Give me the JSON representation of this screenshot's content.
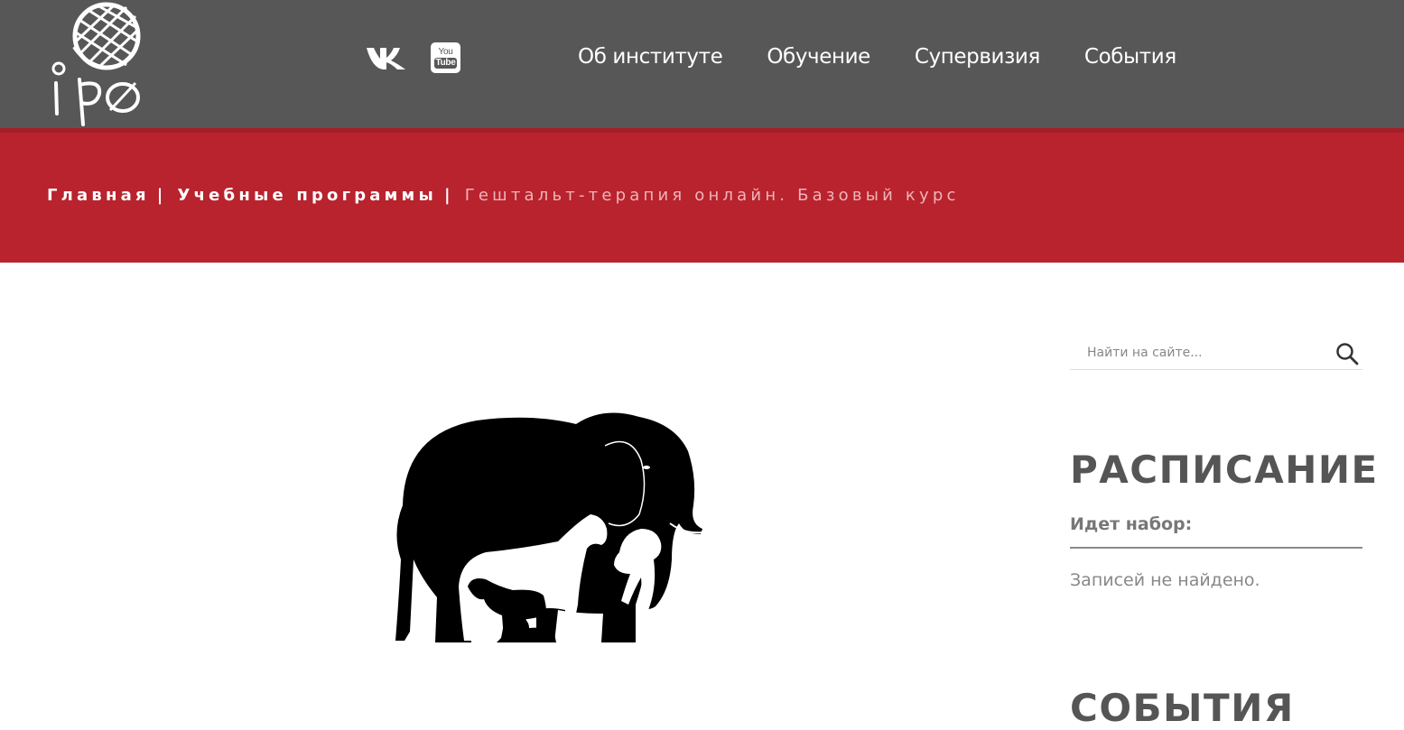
{
  "header": {
    "logo_text": "iPO",
    "social": {
      "vk_icon": "vk-icon",
      "youtube_icon": "youtube-icon",
      "youtube_you": "You",
      "youtube_tube": "Tube"
    },
    "nav": [
      {
        "label": "Об институте"
      },
      {
        "label": "Обучение"
      },
      {
        "label": "Супервизия"
      },
      {
        "label": "События"
      }
    ],
    "background_color": "#575757"
  },
  "breadcrumb": {
    "items": [
      {
        "label": "Главная"
      },
      {
        "label": "Учебные программы"
      }
    ],
    "separator": "|",
    "current": "Гештальт-терапия онлайн. Базовый курс",
    "background_color": "#b8232e"
  },
  "main": {
    "image": "elephant-with-animals-silhouette"
  },
  "sidebar": {
    "search": {
      "placeholder": "Найти на сайте...",
      "icon": "search-icon"
    },
    "schedule": {
      "title": "РАСПИСАНИЕ",
      "subhead": "Идет набор:",
      "empty_text": "Записей не найдено."
    },
    "events": {
      "title": "СОБЫТИЯ"
    }
  }
}
